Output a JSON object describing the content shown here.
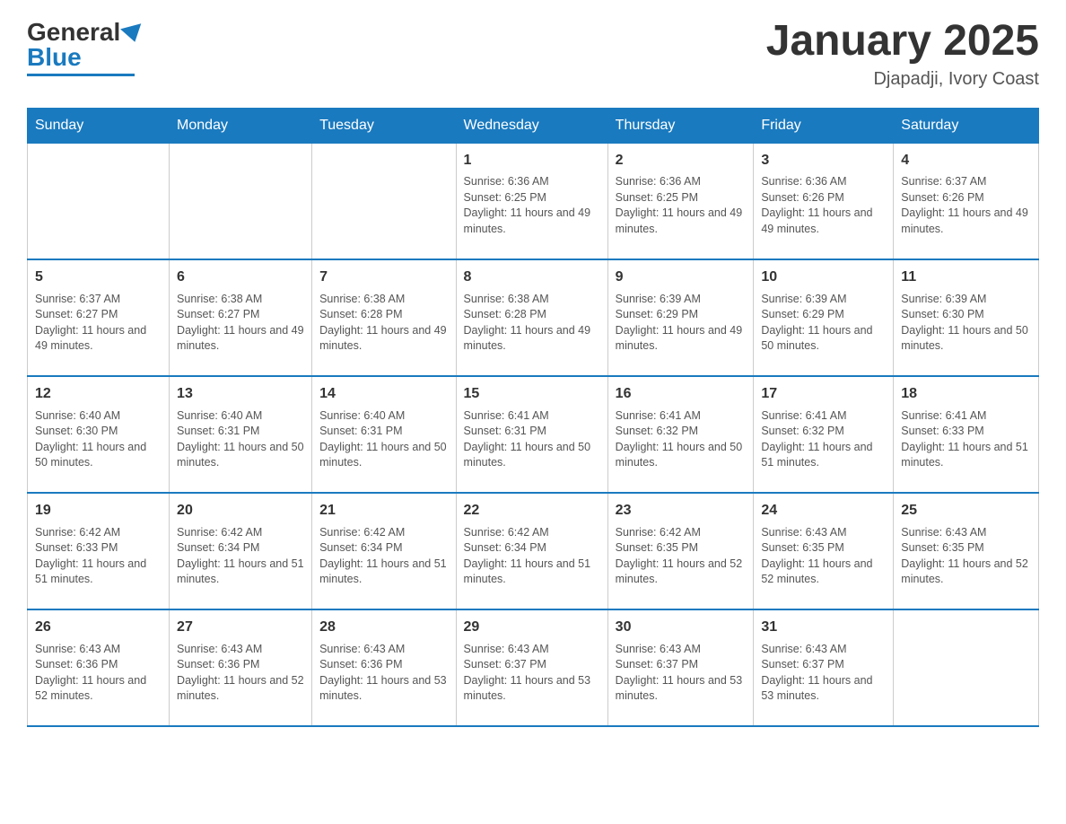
{
  "header": {
    "logo_general": "General",
    "logo_blue": "Blue",
    "month_title": "January 2025",
    "location": "Djapadji, Ivory Coast"
  },
  "days_of_week": [
    "Sunday",
    "Monday",
    "Tuesday",
    "Wednesday",
    "Thursday",
    "Friday",
    "Saturday"
  ],
  "weeks": [
    [
      {
        "day": "",
        "info": ""
      },
      {
        "day": "",
        "info": ""
      },
      {
        "day": "",
        "info": ""
      },
      {
        "day": "1",
        "info": "Sunrise: 6:36 AM\nSunset: 6:25 PM\nDaylight: 11 hours and 49 minutes."
      },
      {
        "day": "2",
        "info": "Sunrise: 6:36 AM\nSunset: 6:25 PM\nDaylight: 11 hours and 49 minutes."
      },
      {
        "day": "3",
        "info": "Sunrise: 6:36 AM\nSunset: 6:26 PM\nDaylight: 11 hours and 49 minutes."
      },
      {
        "day": "4",
        "info": "Sunrise: 6:37 AM\nSunset: 6:26 PM\nDaylight: 11 hours and 49 minutes."
      }
    ],
    [
      {
        "day": "5",
        "info": "Sunrise: 6:37 AM\nSunset: 6:27 PM\nDaylight: 11 hours and 49 minutes."
      },
      {
        "day": "6",
        "info": "Sunrise: 6:38 AM\nSunset: 6:27 PM\nDaylight: 11 hours and 49 minutes."
      },
      {
        "day": "7",
        "info": "Sunrise: 6:38 AM\nSunset: 6:28 PM\nDaylight: 11 hours and 49 minutes."
      },
      {
        "day": "8",
        "info": "Sunrise: 6:38 AM\nSunset: 6:28 PM\nDaylight: 11 hours and 49 minutes."
      },
      {
        "day": "9",
        "info": "Sunrise: 6:39 AM\nSunset: 6:29 PM\nDaylight: 11 hours and 49 minutes."
      },
      {
        "day": "10",
        "info": "Sunrise: 6:39 AM\nSunset: 6:29 PM\nDaylight: 11 hours and 50 minutes."
      },
      {
        "day": "11",
        "info": "Sunrise: 6:39 AM\nSunset: 6:30 PM\nDaylight: 11 hours and 50 minutes."
      }
    ],
    [
      {
        "day": "12",
        "info": "Sunrise: 6:40 AM\nSunset: 6:30 PM\nDaylight: 11 hours and 50 minutes."
      },
      {
        "day": "13",
        "info": "Sunrise: 6:40 AM\nSunset: 6:31 PM\nDaylight: 11 hours and 50 minutes."
      },
      {
        "day": "14",
        "info": "Sunrise: 6:40 AM\nSunset: 6:31 PM\nDaylight: 11 hours and 50 minutes."
      },
      {
        "day": "15",
        "info": "Sunrise: 6:41 AM\nSunset: 6:31 PM\nDaylight: 11 hours and 50 minutes."
      },
      {
        "day": "16",
        "info": "Sunrise: 6:41 AM\nSunset: 6:32 PM\nDaylight: 11 hours and 50 minutes."
      },
      {
        "day": "17",
        "info": "Sunrise: 6:41 AM\nSunset: 6:32 PM\nDaylight: 11 hours and 51 minutes."
      },
      {
        "day": "18",
        "info": "Sunrise: 6:41 AM\nSunset: 6:33 PM\nDaylight: 11 hours and 51 minutes."
      }
    ],
    [
      {
        "day": "19",
        "info": "Sunrise: 6:42 AM\nSunset: 6:33 PM\nDaylight: 11 hours and 51 minutes."
      },
      {
        "day": "20",
        "info": "Sunrise: 6:42 AM\nSunset: 6:34 PM\nDaylight: 11 hours and 51 minutes."
      },
      {
        "day": "21",
        "info": "Sunrise: 6:42 AM\nSunset: 6:34 PM\nDaylight: 11 hours and 51 minutes."
      },
      {
        "day": "22",
        "info": "Sunrise: 6:42 AM\nSunset: 6:34 PM\nDaylight: 11 hours and 51 minutes."
      },
      {
        "day": "23",
        "info": "Sunrise: 6:42 AM\nSunset: 6:35 PM\nDaylight: 11 hours and 52 minutes."
      },
      {
        "day": "24",
        "info": "Sunrise: 6:43 AM\nSunset: 6:35 PM\nDaylight: 11 hours and 52 minutes."
      },
      {
        "day": "25",
        "info": "Sunrise: 6:43 AM\nSunset: 6:35 PM\nDaylight: 11 hours and 52 minutes."
      }
    ],
    [
      {
        "day": "26",
        "info": "Sunrise: 6:43 AM\nSunset: 6:36 PM\nDaylight: 11 hours and 52 minutes."
      },
      {
        "day": "27",
        "info": "Sunrise: 6:43 AM\nSunset: 6:36 PM\nDaylight: 11 hours and 52 minutes."
      },
      {
        "day": "28",
        "info": "Sunrise: 6:43 AM\nSunset: 6:36 PM\nDaylight: 11 hours and 53 minutes."
      },
      {
        "day": "29",
        "info": "Sunrise: 6:43 AM\nSunset: 6:37 PM\nDaylight: 11 hours and 53 minutes."
      },
      {
        "day": "30",
        "info": "Sunrise: 6:43 AM\nSunset: 6:37 PM\nDaylight: 11 hours and 53 minutes."
      },
      {
        "day": "31",
        "info": "Sunrise: 6:43 AM\nSunset: 6:37 PM\nDaylight: 11 hours and 53 minutes."
      },
      {
        "day": "",
        "info": ""
      }
    ]
  ]
}
